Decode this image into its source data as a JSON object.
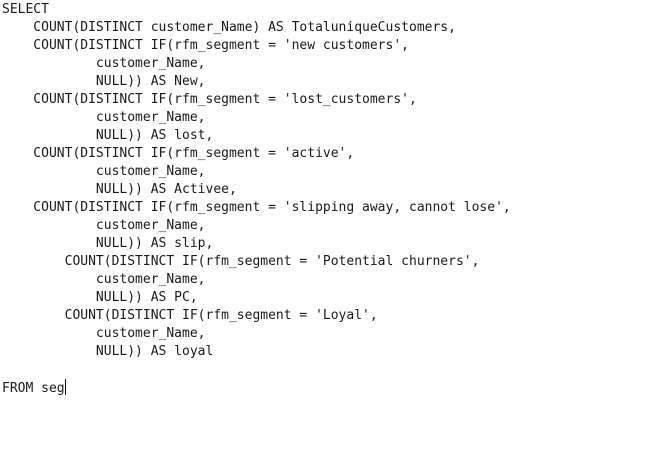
{
  "editor": {
    "lines": [
      "SELECT",
      "    COUNT(DISTINCT customer_Name) AS TotaluniqueCustomers,",
      "    COUNT(DISTINCT IF(rfm_segment = 'new customers',",
      "            customer_Name,",
      "            NULL)) AS New,",
      "    COUNT(DISTINCT IF(rfm_segment = 'lost_customers',",
      "            customer_Name,",
      "            NULL)) AS lost,",
      "    COUNT(DISTINCT IF(rfm_segment = 'active',",
      "            customer_Name,",
      "            NULL)) AS Activee,",
      "    COUNT(DISTINCT IF(rfm_segment = 'slipping away, cannot lose',",
      "            customer_Name,",
      "            NULL)) AS slip,",
      "        COUNT(DISTINCT IF(rfm_segment = 'Potential churners',",
      "            customer_Name,",
      "            NULL)) AS PC,",
      "        COUNT(DISTINCT IF(rfm_segment = 'Loyal',",
      "            customer_Name,",
      "            NULL)) AS loyal",
      "",
      "FROM seg"
    ]
  }
}
